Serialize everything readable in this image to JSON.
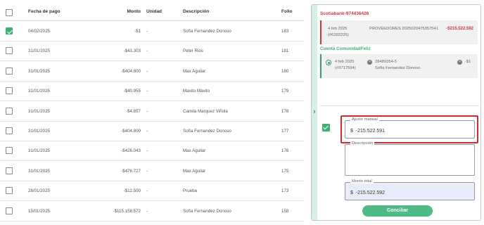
{
  "table": {
    "headers": {
      "fecha": "Fecha de pago",
      "monto": "Monto",
      "unidad": "Unidad",
      "descripcion": "Descripción",
      "folio": "Folio"
    },
    "rows": [
      {
        "checked": true,
        "fecha": "04/02/2025",
        "monto": "-$1",
        "unidad": "-",
        "descripcion": "Sofía Fernandez Donoso",
        "folio": "183"
      },
      {
        "checked": false,
        "fecha": "31/01/2025",
        "monto": "-$43.303",
        "unidad": "-",
        "descripcion": "Peter Rios",
        "folio": "181"
      },
      {
        "checked": false,
        "fecha": "31/01/2025",
        "monto": "-$404.800",
        "unidad": "-",
        "descripcion": "Max Aguilar",
        "folio": "180"
      },
      {
        "checked": false,
        "fecha": "31/01/2025",
        "monto": "-$40.955",
        "unidad": "-",
        "descripcion": "Maxito Maxito",
        "folio": "179"
      },
      {
        "checked": false,
        "fecha": "31/01/2025",
        "monto": "-$4.857",
        "unidad": "-",
        "descripcion": "Camila Marquez Viñola",
        "folio": "178"
      },
      {
        "checked": false,
        "fecha": "31/01/2025",
        "monto": "-$404.800",
        "unidad": "-",
        "descripcion": "Sofía Fernandez Donoso",
        "folio": "177"
      },
      {
        "checked": false,
        "fecha": "31/01/2025",
        "monto": "-$426.043",
        "unidad": "-",
        "descripcion": "Max Aguilar",
        "folio": "176"
      },
      {
        "checked": false,
        "fecha": "31/01/2025",
        "monto": "-$476.727",
        "unidad": "-",
        "descripcion": "Max Aguilar",
        "folio": "175"
      },
      {
        "checked": false,
        "fecha": "28/01/2025",
        "monto": "-$12.500",
        "unidad": "-",
        "descripcion": "Prueba",
        "folio": "173"
      },
      {
        "checked": false,
        "fecha": "15/01/2025",
        "monto": "-$115.158.572",
        "unidad": "-",
        "descripcion": "Sofía Fernandez Donoso",
        "folio": "158"
      }
    ]
  },
  "panel": {
    "bank_title": "Scotiabank-974436426",
    "bank_card": {
      "date": "4 feb 2025",
      "ref": "(#6392225)",
      "description": "PROVEEDORES 2025020475357541",
      "amount": "-$215.522.592"
    },
    "account_title": "Cuenta ComunidadFeliz",
    "account_card": {
      "date": "4 feb 2025",
      "ref": "(#3717594)",
      "folio": "28489354-5",
      "name": "Sofía Fernandez Donoso",
      "amount": "-$1"
    },
    "ajuste": {
      "label": "Ajuste manual",
      "currency": "$",
      "value": "-215.522.591"
    },
    "descripcion": {
      "label": "Descripción",
      "value": ""
    },
    "monto_total": {
      "label": "Monto total",
      "currency": "$",
      "value": "-215.522.592"
    },
    "conciliar_label": "Conciliar"
  },
  "icons": {
    "collapse": "chevron-right-icon",
    "remove": "x-circle-icon"
  },
  "colors": {
    "accent": "#4cbb85",
    "danger": "#e0303a",
    "highlight": "#d52b2b"
  }
}
